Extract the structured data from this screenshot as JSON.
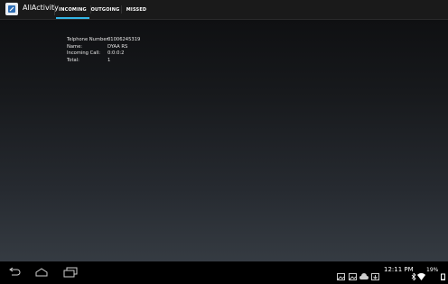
{
  "app": {
    "title": "AllActivity",
    "icon": "app-icon"
  },
  "tabs": [
    {
      "label": "INCOMING",
      "active": true
    },
    {
      "label": "OUTGOING",
      "active": false
    },
    {
      "label": "MISSED",
      "active": false
    }
  ],
  "accent_color": "#33b5e5",
  "details": {
    "telephone_label": "Telphone Number:",
    "telephone_value": "01006245319",
    "name_label": "Name:",
    "name_value": "DYAA RS",
    "incoming_label": "Incoming Call:",
    "incoming_value": "0:0:0:2",
    "total_label": "Total:",
    "total_value": "1"
  },
  "navbar": {
    "back": "back-icon",
    "home": "home-icon",
    "recents": "recents-icon"
  },
  "status": {
    "time": "12:11 PM",
    "battery": "19%"
  }
}
